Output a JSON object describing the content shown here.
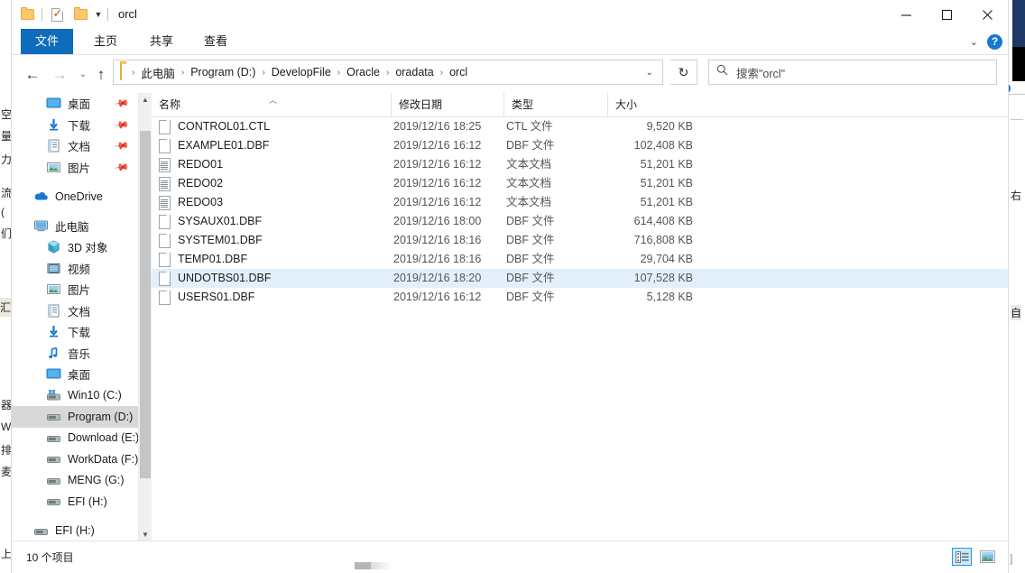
{
  "window": {
    "title": "orcl",
    "minimize_label": "最小化",
    "maximize_label": "最大化",
    "close_label": "关闭"
  },
  "quick_access_toolbar": {
    "folder_label": "属性",
    "properties_label": "属性",
    "new_folder_label": "新建文件夹",
    "customize_label": "自定义快速访问工具栏"
  },
  "ribbon": {
    "tabs": [
      {
        "label": "文件",
        "active": true
      },
      {
        "label": "主页",
        "active": false
      },
      {
        "label": "共享",
        "active": false
      },
      {
        "label": "查看",
        "active": false
      }
    ],
    "expand_label": "展开功能区",
    "help_label": "?"
  },
  "navigation": {
    "back_label": "后退",
    "forward_label": "前进",
    "recent_label": "最近浏览的位置",
    "up_label": "向上",
    "refresh_label": "刷新",
    "breadcrumb": [
      "此电脑",
      "Program (D:)",
      "DevelopFile",
      "Oracle",
      "oradata",
      "orcl"
    ],
    "breadcrumb_separator": "›",
    "dropdown_label": "⌄"
  },
  "search": {
    "placeholder": "搜索\"orcl\"",
    "icon": "search-icon"
  },
  "sidebar": {
    "groups": [
      {
        "items": [
          {
            "label": "桌面",
            "icon": "desktop-icon",
            "pinned": true,
            "indent": 1,
            "selected": false
          },
          {
            "label": "下载",
            "icon": "download-icon",
            "pinned": true,
            "indent": 1,
            "selected": false
          },
          {
            "label": "文档",
            "icon": "documents-icon",
            "pinned": true,
            "indent": 1,
            "selected": false
          },
          {
            "label": "图片",
            "icon": "pictures-icon",
            "pinned": true,
            "indent": 1,
            "selected": false
          }
        ]
      },
      {
        "items": [
          {
            "label": "OneDrive",
            "icon": "onedrive-icon",
            "pinned": false,
            "indent": 0,
            "selected": false
          }
        ]
      },
      {
        "items": [
          {
            "label": "此电脑",
            "icon": "this-pc-icon",
            "pinned": false,
            "indent": 0,
            "selected": false
          },
          {
            "label": "3D 对象",
            "icon": "3d-objects-icon",
            "pinned": false,
            "indent": 1,
            "selected": false
          },
          {
            "label": "视频",
            "icon": "videos-icon",
            "pinned": false,
            "indent": 1,
            "selected": false
          },
          {
            "label": "图片",
            "icon": "pictures-icon",
            "pinned": false,
            "indent": 1,
            "selected": false
          },
          {
            "label": "文档",
            "icon": "documents-icon",
            "pinned": false,
            "indent": 1,
            "selected": false
          },
          {
            "label": "下载",
            "icon": "download-icon",
            "pinned": false,
            "indent": 1,
            "selected": false
          },
          {
            "label": "音乐",
            "icon": "music-icon",
            "pinned": false,
            "indent": 1,
            "selected": false
          },
          {
            "label": "桌面",
            "icon": "desktop-icon",
            "pinned": false,
            "indent": 1,
            "selected": false
          },
          {
            "label": "Win10 (C:)",
            "icon": "system-drive-icon",
            "pinned": false,
            "indent": 1,
            "selected": false
          },
          {
            "label": "Program (D:)",
            "icon": "drive-icon",
            "pinned": false,
            "indent": 1,
            "selected": true
          },
          {
            "label": "Download (E:)",
            "icon": "drive-icon",
            "pinned": false,
            "indent": 1,
            "selected": false
          },
          {
            "label": "WorkData (F:)",
            "icon": "drive-icon",
            "pinned": false,
            "indent": 1,
            "selected": false
          },
          {
            "label": "MENG (G:)",
            "icon": "drive-icon",
            "pinned": false,
            "indent": 1,
            "selected": false
          },
          {
            "label": "EFI (H:)",
            "icon": "drive-icon",
            "pinned": false,
            "indent": 1,
            "selected": false
          }
        ]
      },
      {
        "items": [
          {
            "label": "EFI (H:)",
            "icon": "drive-icon",
            "pinned": false,
            "indent": 0,
            "selected": false
          }
        ]
      }
    ]
  },
  "file_list": {
    "columns": [
      {
        "label": "名称",
        "sorted": true,
        "sort_direction": "asc"
      },
      {
        "label": "修改日期",
        "sorted": false
      },
      {
        "label": "类型",
        "sorted": false
      },
      {
        "label": "大小",
        "sorted": false
      }
    ],
    "rows": [
      {
        "name": "CONTROL01.CTL",
        "date": "2019/12/16 18:25",
        "type": "CTL 文件",
        "size": "9,520 KB",
        "icon": "blank-file-icon",
        "highlighted": false
      },
      {
        "name": "EXAMPLE01.DBF",
        "date": "2019/12/16 16:12",
        "type": "DBF 文件",
        "size": "102,408 KB",
        "icon": "blank-file-icon",
        "highlighted": false
      },
      {
        "name": "REDO01",
        "date": "2019/12/16 16:12",
        "type": "文本文档",
        "size": "51,201 KB",
        "icon": "text-file-icon",
        "highlighted": false
      },
      {
        "name": "REDO02",
        "date": "2019/12/16 16:12",
        "type": "文本文档",
        "size": "51,201 KB",
        "icon": "text-file-icon",
        "highlighted": false
      },
      {
        "name": "REDO03",
        "date": "2019/12/16 16:12",
        "type": "文本文档",
        "size": "51,201 KB",
        "icon": "text-file-icon",
        "highlighted": false
      },
      {
        "name": "SYSAUX01.DBF",
        "date": "2019/12/16 18:00",
        "type": "DBF 文件",
        "size": "614,408 KB",
        "icon": "blank-file-icon",
        "highlighted": false
      },
      {
        "name": "SYSTEM01.DBF",
        "date": "2019/12/16 18:16",
        "type": "DBF 文件",
        "size": "716,808 KB",
        "icon": "blank-file-icon",
        "highlighted": false
      },
      {
        "name": "TEMP01.DBF",
        "date": "2019/12/16 18:16",
        "type": "DBF 文件",
        "size": "29,704 KB",
        "icon": "blank-file-icon",
        "highlighted": false
      },
      {
        "name": "UNDOTBS01.DBF",
        "date": "2019/12/16 18:20",
        "type": "DBF 文件",
        "size": "107,528 KB",
        "icon": "blank-file-icon",
        "highlighted": true
      },
      {
        "name": "USERS01.DBF",
        "date": "2019/12/16 16:12",
        "type": "DBF 文件",
        "size": "5,128 KB",
        "icon": "blank-file-icon",
        "highlighted": false
      }
    ]
  },
  "status_bar": {
    "item_count_text": "10 个项目",
    "details_view_label": "详细信息",
    "large_icons_view_label": "大图标"
  },
  "colors": {
    "accent": "#0f6cbd",
    "selection": "#e3f0fb",
    "sidebar_selection": "#d8d8d8",
    "folder_yellow": "#fdc86a",
    "help_blue": "#1878d0"
  }
}
